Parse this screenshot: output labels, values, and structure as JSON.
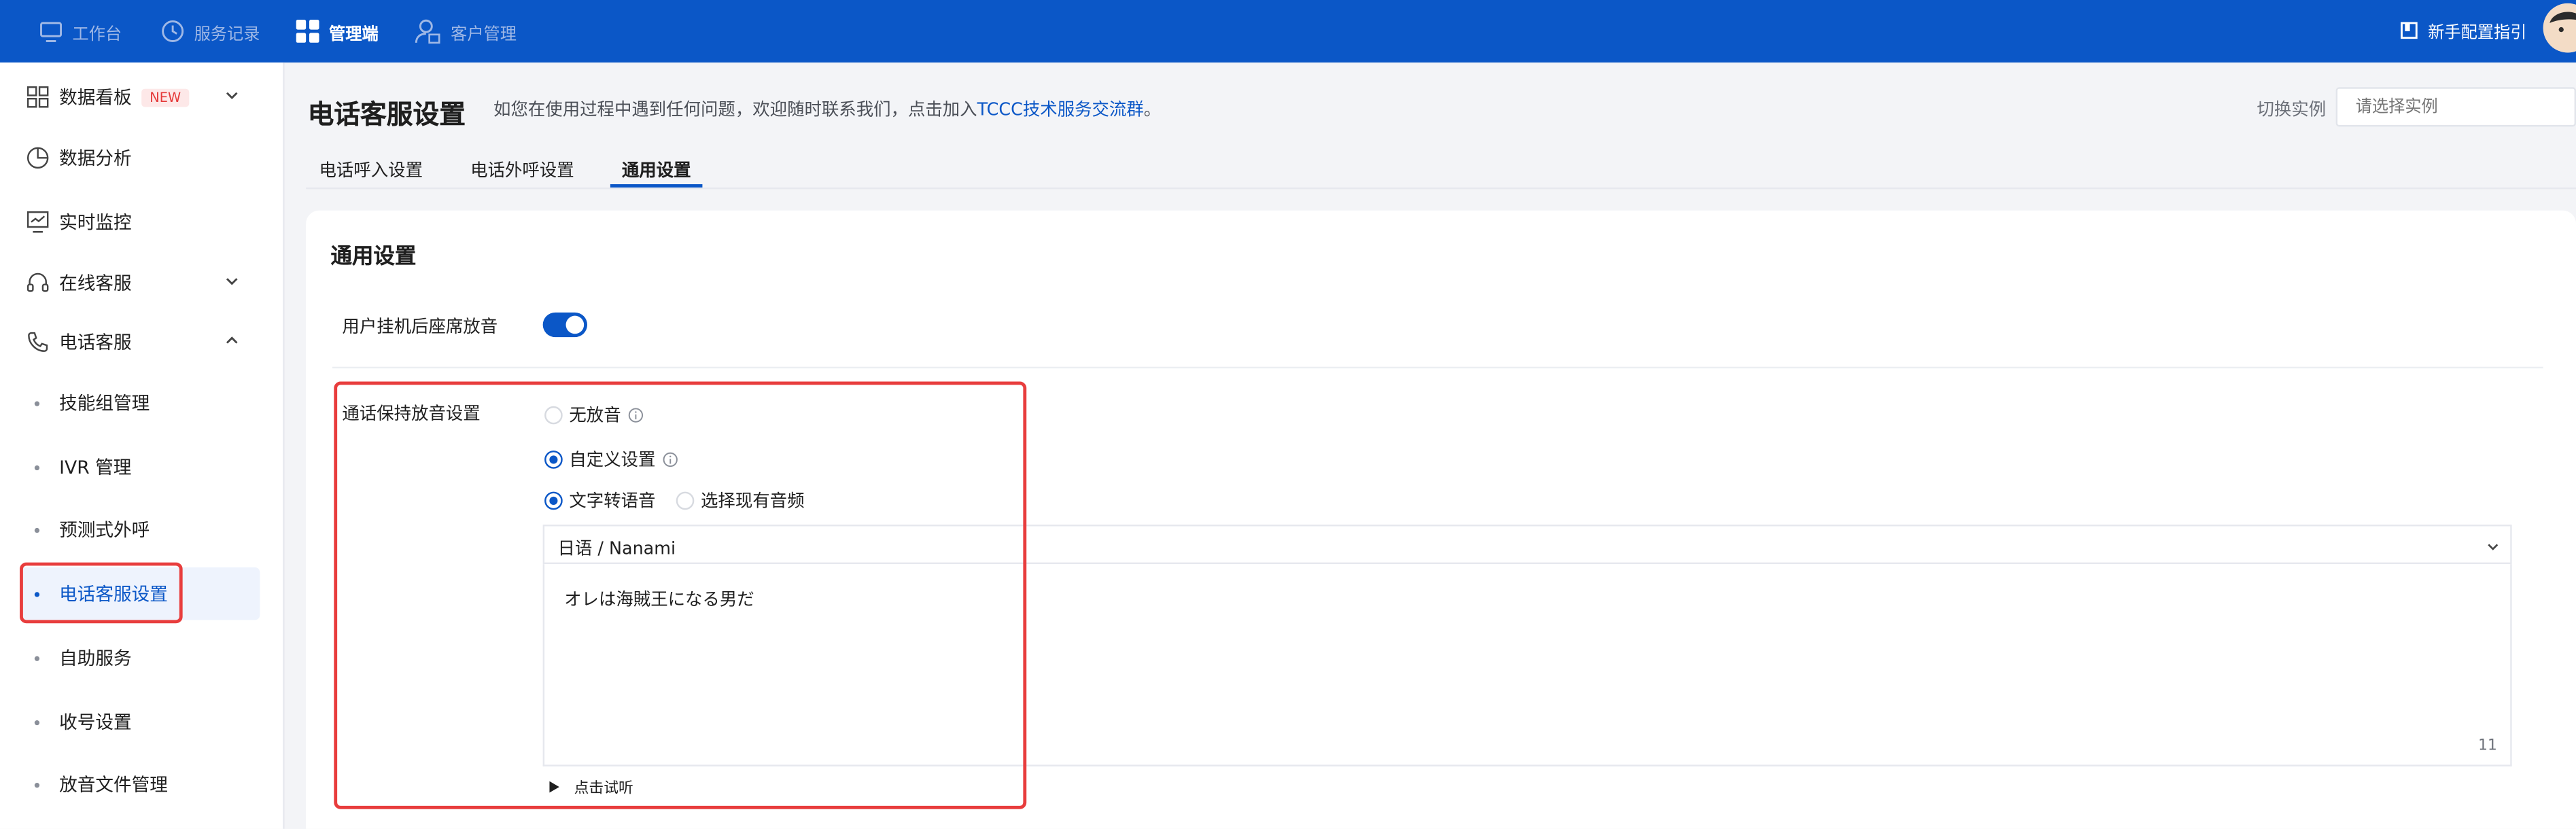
{
  "topnav": {
    "items": [
      {
        "label": "工作台",
        "icon": "monitor-icon"
      },
      {
        "label": "服务记录",
        "icon": "clock-icon"
      },
      {
        "label": "管理端",
        "icon": "grid-icon"
      },
      {
        "label": "客户管理",
        "icon": "user-icon"
      }
    ],
    "active": "管理端",
    "guide_label": "新手配置指引"
  },
  "sidebar": {
    "items": [
      {
        "label": "数据看板",
        "badge": "NEW",
        "icon": "dashboard-icon",
        "expandable": true
      },
      {
        "label": "数据分析",
        "icon": "pie-chart-icon"
      },
      {
        "label": "实时监控",
        "icon": "monitor-chart-icon"
      },
      {
        "label": "在线客服",
        "icon": "headset-icon",
        "expandable": true
      },
      {
        "label": "电话客服",
        "icon": "phone-icon",
        "expanded": true
      }
    ],
    "sub_items": [
      {
        "label": "技能组管理"
      },
      {
        "label": "IVR 管理"
      },
      {
        "label": "预测式外呼"
      },
      {
        "label": "电话客服设置",
        "active": true
      },
      {
        "label": "自助服务"
      },
      {
        "label": "收号设置"
      },
      {
        "label": "放音文件管理"
      }
    ]
  },
  "header": {
    "title": "电话客服设置",
    "description": "如您在使用过程中遇到任何问题，欢迎随时联系我们，点击加入",
    "link_text": "TCCC技术服务交流群",
    "description_end": "。",
    "switch_instance_label": "切换实例",
    "instance_placeholder": "请选择实例"
  },
  "tabs": [
    {
      "label": "电话呼入设置"
    },
    {
      "label": "电话外呼设置"
    },
    {
      "label": "通用设置",
      "active": true
    }
  ],
  "settings": {
    "section_title": "通用设置",
    "hangup_playback_label": "用户挂机后座席放音",
    "hangup_playback_enabled": true,
    "hold_music_label": "通话保持放音设置",
    "hold_options": [
      {
        "label": "无放音",
        "checked": false
      },
      {
        "label": "自定义设置",
        "checked": true
      }
    ],
    "source_options": [
      {
        "label": "文字转语音",
        "checked": true
      },
      {
        "label": "选择现有音频",
        "checked": false
      }
    ],
    "voice_value": "日语 / Nanami",
    "tts_text": "オレは海賊王になる男だ",
    "char_count": "11",
    "preview_label": "点击试听"
  },
  "colors": {
    "primary": "#0b57c7",
    "highlight": "#e83d3d",
    "badge_bg": "#fde8e8",
    "badge_text": "#e53a3a"
  }
}
